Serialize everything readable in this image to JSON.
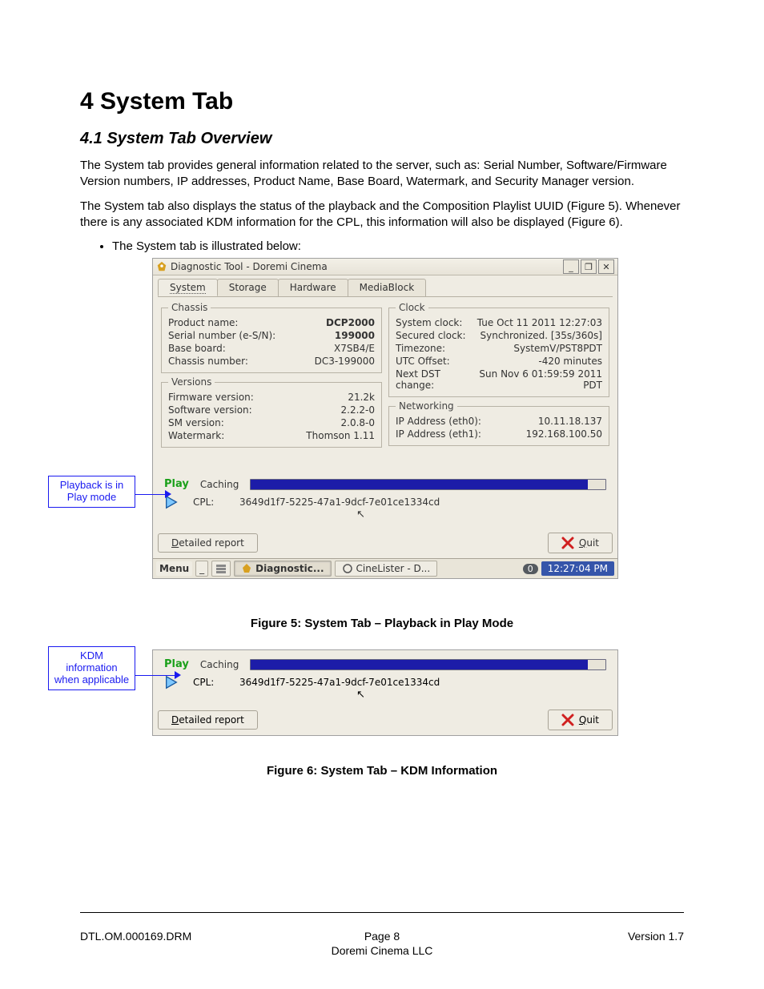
{
  "doc": {
    "h1": "4   System Tab",
    "h2": "4.1   System Tab Overview",
    "para1": "The System tab provides general information related to the server, such as: Serial Number, Software/Firmware Version numbers, IP addresses, Product Name, Base Board, Watermark, and Security Manager version.",
    "para2": "The System tab also displays the status of the playback and the Composition Playlist UUID (Figure 5). Whenever there is any associated KDM information for the CPL, this information will also be displayed (Figure 6).",
    "bullet1": "The System tab is illustrated below:",
    "callout1": "Playback is in Play mode",
    "callout2": "KDM information when applicable",
    "fig5": "Figure 5: System Tab – Playback in Play Mode",
    "fig6": "Figure 6: System Tab – KDM Information",
    "footer_left": "DTL.OM.000169.DRM",
    "footer_center": "Page 8",
    "footer_right": "Version 1.7",
    "footer_company": "Doremi Cinema LLC"
  },
  "app": {
    "title": "Diagnostic Tool - Doremi Cinema",
    "tabs": [
      "System",
      "Storage",
      "Hardware",
      "MediaBlock"
    ],
    "chassis": {
      "legend": "Chassis",
      "rows": [
        {
          "k": "Product name:",
          "v": "DCP2000"
        },
        {
          "k": "Serial number (e-S/N):",
          "v": "199000"
        },
        {
          "k": "Base board:",
          "v": "X7SB4/E"
        },
        {
          "k": "Chassis number:",
          "v": "DC3-199000"
        }
      ]
    },
    "versions": {
      "legend": "Versions",
      "rows": [
        {
          "k": "Firmware version:",
          "v": "21.2k"
        },
        {
          "k": "Software version:",
          "v": "2.2.2-0"
        },
        {
          "k": "SM version:",
          "v": "2.0.8-0"
        },
        {
          "k": "Watermark:",
          "v": "Thomson 1.11"
        }
      ]
    },
    "clock": {
      "legend": "Clock",
      "rows": [
        {
          "k": "System clock:",
          "v": "Tue Oct 11 2011 12:27:03"
        },
        {
          "k": "Secured clock:",
          "v": "Synchronized. [35s/360s]"
        },
        {
          "k": "Timezone:",
          "v": "SystemV/PST8PDT"
        },
        {
          "k": "UTC Offset:",
          "v": "-420 minutes"
        },
        {
          "k": "Next DST change:",
          "v": "Sun Nov  6 01:59:59 2011 PDT"
        }
      ]
    },
    "net": {
      "legend": "Networking",
      "rows": [
        {
          "k": "IP Address (eth0):",
          "v": "10.11.18.137"
        },
        {
          "k": "IP Address (eth1):",
          "v": "192.168.100.50"
        }
      ]
    },
    "play": {
      "status": "Play",
      "caching": "Caching",
      "cpl_label": "CPL:",
      "cpl_value": "3649d1f7-5225-47a1-9dcf-7e01ce1334cd"
    },
    "buttons": {
      "report": "Detailed report",
      "quit": "Quit"
    },
    "taskbar": {
      "menu": "Menu",
      "task_diag": "Diagnostic...",
      "task_cine": "CineLister - D...",
      "pill": "0",
      "clock": "12:27:04 PM"
    }
  }
}
